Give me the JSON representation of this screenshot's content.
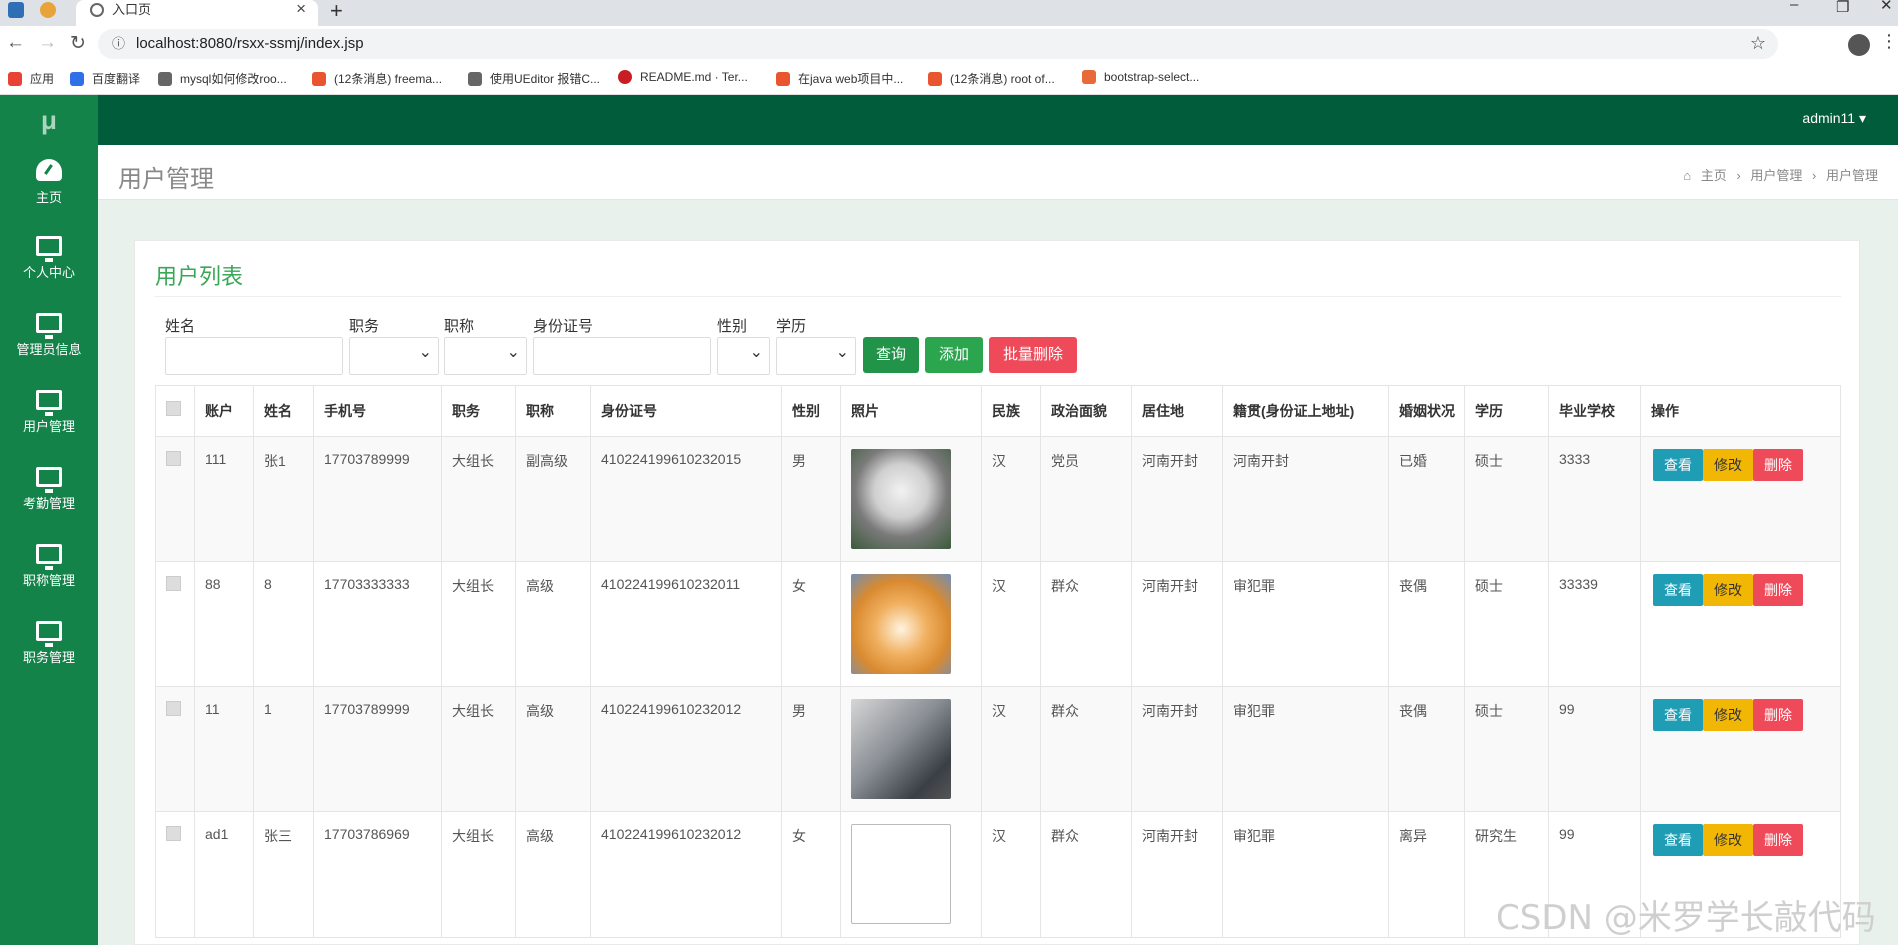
{
  "browser": {
    "tab_title": "入口页",
    "url": "localhost:8080/rsxx-ssmj/index.jsp",
    "bookmarks": [
      "应用",
      "百度翻译",
      "mysql如何修改roo...",
      "(12条消息) freema...",
      "使用UEditor 报错C...",
      "README.md · Ter...",
      "在java web项目中...",
      "(12条消息) root of...",
      "bootstrap-select..."
    ]
  },
  "app": {
    "logo": "μ",
    "user": "admin11 ▾",
    "nav": [
      {
        "label": "主页",
        "icon": "dashboard-icon"
      },
      {
        "label": "个人中心",
        "icon": "monitor-icon"
      },
      {
        "label": "管理员信息",
        "icon": "monitor-icon"
      },
      {
        "label": "用户管理",
        "icon": "monitor-icon"
      },
      {
        "label": "考勤管理",
        "icon": "monitor-icon"
      },
      {
        "label": "职称管理",
        "icon": "monitor-icon"
      },
      {
        "label": "职务管理",
        "icon": "monitor-icon"
      }
    ],
    "page_title": "用户管理",
    "breadcrumb": [
      "主页",
      "用户管理",
      "用户管理"
    ],
    "panel_title": "用户列表",
    "filters": {
      "labels": [
        "姓名",
        "职务",
        "职称",
        "身份证号",
        "性别",
        "学历"
      ],
      "buttons": [
        "查询",
        "添加",
        "批量删除"
      ]
    },
    "table": {
      "headers": [
        "账户",
        "姓名",
        "手机号",
        "职务",
        "职称",
        "身份证号",
        "性别",
        "照片",
        "民族",
        "政治面貌",
        "居住地",
        "籍贯(身份证上地址)",
        "婚姻状况",
        "学历",
        "毕业学校",
        "操作"
      ],
      "rows": [
        {
          "cells": [
            "111",
            "张1",
            "17703789999",
            "大组长",
            "副高级",
            "410224199610232015",
            "男",
            "",
            "汉",
            "党员",
            "河南开封",
            "河南开封",
            "已婚",
            "硕士",
            "3333"
          ],
          "photo": "cat"
        },
        {
          "cells": [
            "88",
            "8",
            "17703333333",
            "大组长",
            "高级",
            "410224199610232011",
            "女",
            "",
            "汉",
            "群众",
            "河南开封",
            "审犯罪",
            "丧偶",
            "硕士",
            "33339"
          ],
          "photo": "shiba"
        },
        {
          "cells": [
            "11",
            "1",
            "17703789999",
            "大组长",
            "高级",
            "410224199610232012",
            "男",
            "",
            "汉",
            "群众",
            "河南开封",
            "审犯罪",
            "丧偶",
            "硕士",
            "99"
          ],
          "photo": "husky"
        },
        {
          "cells": [
            "ad1",
            "张三",
            "17703786969",
            "大组长",
            "高级",
            "410224199610232012",
            "女",
            "",
            "汉",
            "群众",
            "河南开封",
            "审犯罪",
            "离异",
            "研究生",
            "99"
          ],
          "photo": "broken"
        }
      ],
      "actions": [
        "查看",
        "修改",
        "删除"
      ]
    },
    "watermark": "CSDN @米罗学长敲代码"
  },
  "colors": {
    "sidebar": "#14834a",
    "topbar": "#005c3b",
    "view_btn": "#1f9db5",
    "edit_btn": "#f2b705",
    "delete_btn": "#ee4a5a",
    "query_btn": "#21944a"
  }
}
